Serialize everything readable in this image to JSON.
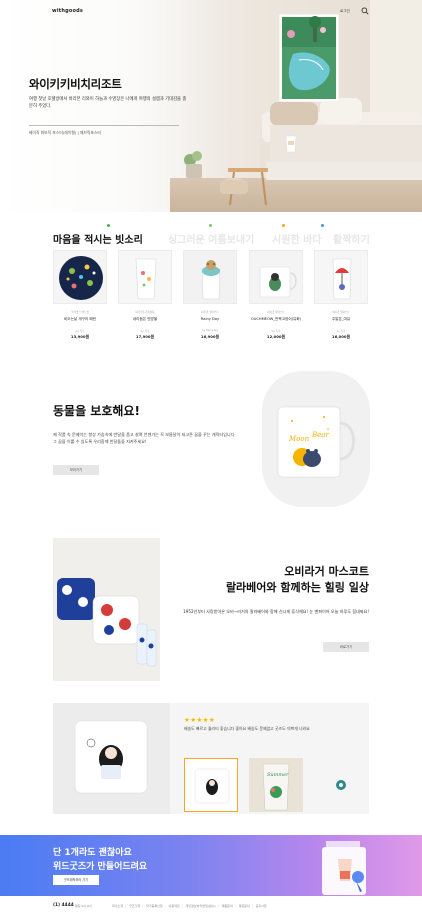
{
  "header": {
    "logo": "withgoods",
    "login_label": "로그인"
  },
  "hero": {
    "title": "와이키키비치리조트",
    "description": "여행 첫날 호텔방에서 바라본 리와이 하늘과 수영장은 나에게 여행의 설렘과 기대감을 충분히 주었다.",
    "sub_links": "베이직 화보직 포스터(레이형) | 패브릭포스터"
  },
  "categories": [
    {
      "label": "마음을 적시는 빗소리",
      "active": true,
      "dot_color": "#4caf50"
    },
    {
      "label": "싱그러운 여름보내기",
      "active": false,
      "dot_color": "#7bc96f"
    },
    {
      "label": "시원한 바다",
      "active": false,
      "dot_color": "#f5a623"
    },
    {
      "label": "활짝하기",
      "active": false,
      "dot_color": "#4a90e2"
    }
  ],
  "products": [
    {
      "brand": "작가명 브랜드명",
      "name": "비오는날 개구리 패턴",
      "label": "by 작가",
      "price": "13,900원"
    },
    {
      "brand": "내가만든기획상품",
      "name": "내리듬은 빗방울",
      "label": "by 작가",
      "price": "17,900원"
    },
    {
      "brand": "아기곰 일러스트",
      "name": "Rainy Day",
      "label": "by Rainyday",
      "price": "16,900원"
    },
    {
      "brand": "아기곰 일러스트",
      "name": "OUCHMEOW_반짝고양이(유화)",
      "label": "by 작가",
      "price": "12,000원"
    },
    {
      "brand": "아기곰 일러스트",
      "name": "주말은_여유",
      "label": "by 작가",
      "price": "16,000원"
    }
  ],
  "animal": {
    "title": "동물을 보호해요!",
    "description": "제 작품 속 문베이는 항상 가슴속에 반달을 품고 살며 언젠가는 꼭 보름달이 되고픈 꿈을 꾸는 캐릭터입니다 그 꿈을 이룰 수 있도록 우리함께 반달돌을 지켜주세요!",
    "button": "보러가기"
  },
  "olivier": {
    "title_line1": "오비라거 마스코트",
    "title_line2": "랄라베어와 함께하는 힐링 일상",
    "description": "1952년부터 사랑받아온 오비~라거의 랄라베어와 함께 신나게 휴식해요! 눈 맨퍼이어 오늘 하루도 힘내봐요!",
    "button": "바로가기"
  },
  "review": {
    "stars": "★★★★★",
    "text": "배송도 빠르고 퀄리티 좋습니다 좋아요 배송도 문제없고 굿즈도 이쁘게 나와요"
  },
  "banner": {
    "line1": "단 1개라도 괜찮아요",
    "line2": "위드굿즈가 만들어드려요",
    "button": "굿즈제작하러 가기"
  },
  "footer": {
    "phone": "(1) 4444",
    "hours": "평일 9시-6시",
    "links": [
      "회사소개",
      "굿즈가게",
      "작가등록신청",
      "이용약관",
      "개인정보처리방침(필수)",
      "제품문의",
      "제휴문의",
      "공지사항"
    ]
  }
}
